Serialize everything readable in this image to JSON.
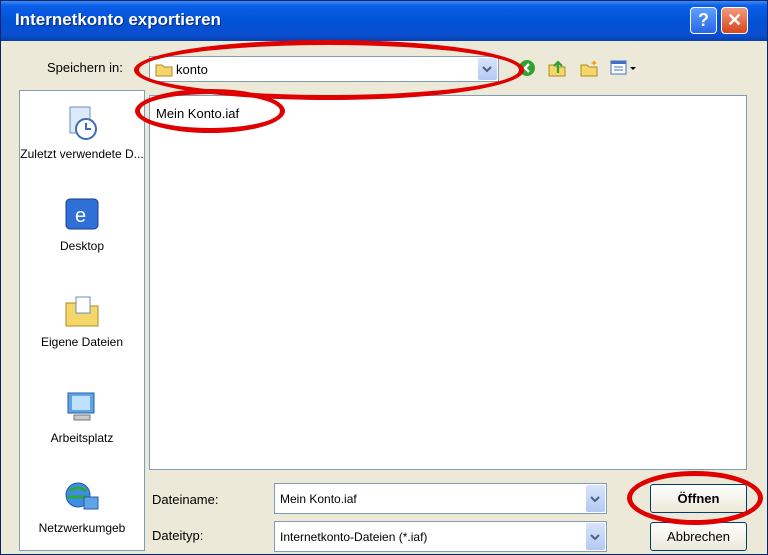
{
  "window": {
    "title": "Internetkonto exportieren"
  },
  "titlebar": {
    "help_label": "?",
    "close_label": "✕"
  },
  "toolbar": {
    "save_in_label": "Speichern in:",
    "location_value": "konto",
    "icons": [
      "back-icon",
      "up-folder-icon",
      "new-folder-icon",
      "view-menu-icon"
    ]
  },
  "places": [
    {
      "label": "Zuletzt verwendete D...",
      "icon": "recent-documents-icon"
    },
    {
      "label": "Desktop",
      "icon": "desktop-icon"
    },
    {
      "label": "Eigene Dateien",
      "icon": "my-documents-icon"
    },
    {
      "label": "Arbeitsplatz",
      "icon": "my-computer-icon"
    },
    {
      "label": "Netzwerkumgeb",
      "icon": "network-icon"
    }
  ],
  "files": [
    {
      "name": "Mein Konto.iaf"
    }
  ],
  "filename": {
    "label": "Dateiname:",
    "value": "Mein Konto.iaf"
  },
  "filetype": {
    "label": "Dateityp:",
    "value": "Internetkonto-Dateien (*.iaf)"
  },
  "buttons": {
    "open": "Öffnen",
    "cancel": "Abbrechen"
  },
  "colors": {
    "annotation_red": "#e00000",
    "titlebar_blue": "#0052d6"
  }
}
